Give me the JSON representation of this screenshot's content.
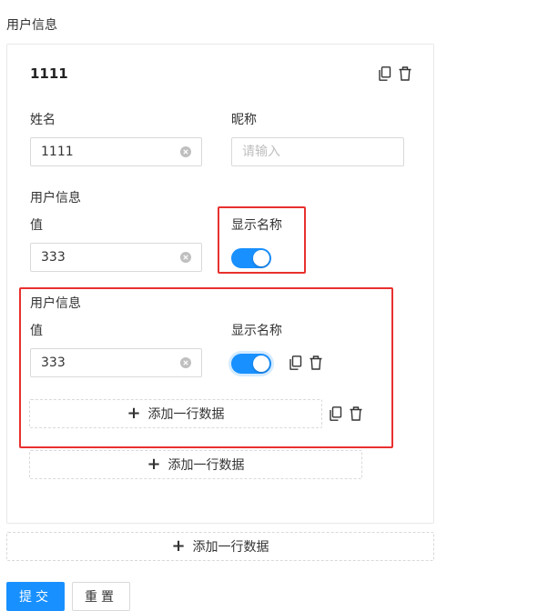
{
  "form": {
    "section_title": "用户信息"
  },
  "card": {
    "title": "1111",
    "name_label": "姓名",
    "name_value": "1111",
    "nickname_label": "昵称",
    "nickname_placeholder": "请输入",
    "group_label": "用户信息",
    "value_label": "值",
    "value": "333",
    "show_name_label": "显示名称",
    "show_name_on": true
  },
  "nested_item": {
    "group_label": "用户信息",
    "value_label": "值",
    "value": "333",
    "show_name_label": "显示名称",
    "show_name_on": true,
    "add_row_label": "添加一行数据"
  },
  "card_add_row_label": "添加一行数据",
  "outer_add_row_label": "添加一行数据",
  "buttons": {
    "submit": "提交",
    "reset": "重置"
  },
  "colors": {
    "primary": "#1890ff",
    "highlight_border": "#e8312f"
  }
}
